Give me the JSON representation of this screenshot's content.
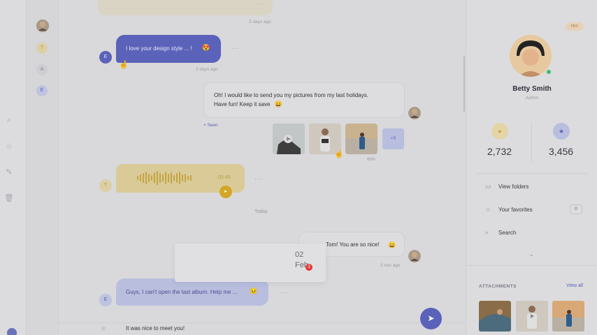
{
  "colors": {
    "accent": "#5b62b9",
    "gold": "#d9ca98",
    "blue_badge": "#b9bedf"
  },
  "sidebar": {
    "icons": [
      "search-icon",
      "star-icon",
      "pencil-icon",
      "trash-icon"
    ],
    "contacts": [
      "T",
      "A",
      "E"
    ]
  },
  "messages": {
    "time_top": "3 days ago",
    "msg1": {
      "sender": "E",
      "text": "I love your design style ... !",
      "emoji": "😍",
      "time": "2 days ago"
    },
    "msg2": {
      "text_line1": "Oh! I would like to send you my pictures from my last holidays.",
      "text_line2": "Have fun! Keep it save",
      "emoji": "😄",
      "seen": "+ Seen"
    },
    "media": {
      "more": "+5",
      "progress": "68%"
    },
    "voice": {
      "sender": "T",
      "duration": "02:45"
    },
    "divider": "Today",
    "msg3": {
      "text": "Tom! You are so nice!",
      "emoji": "😄",
      "time": "3 min ago"
    },
    "msg4": {
      "sender": "E",
      "text": "Guys, I can't open the last album. Help me ...",
      "emoji": "😣"
    }
  },
  "date_popup": {
    "day": "02",
    "month": "Feb",
    "count": "3"
  },
  "composer": {
    "value": "It was nice to meet you!"
  },
  "profile": {
    "badge": "PRO",
    "name": "Betty Smith",
    "role": "Admin",
    "stat1": "2,732",
    "stat2": "3,456",
    "menu": {
      "folders": "View folders",
      "favorites": "Your favorites",
      "favorites_count": "8",
      "search": "Search"
    },
    "attachments_title": "ATTACHMENTS",
    "view_all": "View all"
  }
}
